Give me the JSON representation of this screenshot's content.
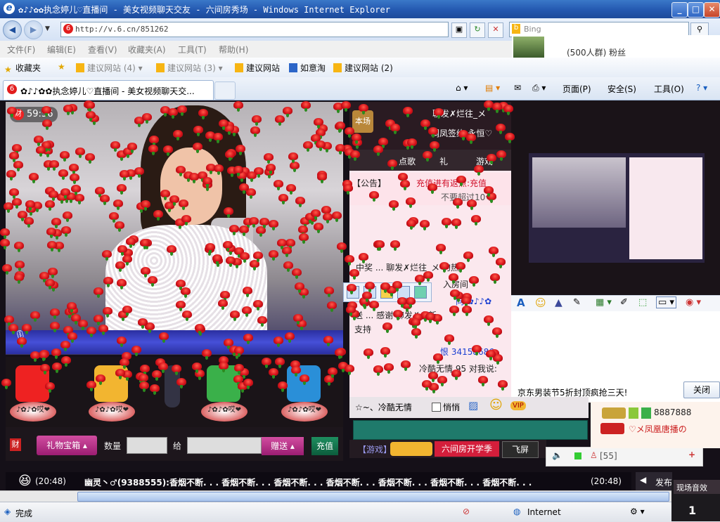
{
  "window": {
    "title": "✿♪♪✿✿执念婷儿♡直播间 - 美女视频聊天交友 - 六间房秀场 - Windows Internet Explorer"
  },
  "address": {
    "url": "http://v.6.cn/851262",
    "search_placeholder": "Bing"
  },
  "menu": [
    "文件(F)",
    "编辑(E)",
    "查看(V)",
    "收藏夹(A)",
    "工具(T)",
    "帮助(H)"
  ],
  "favorites": {
    "label": "收藏夹",
    "items": [
      {
        "label": "建议网站 (4)"
      },
      {
        "label": "建议网站 (3)"
      },
      {
        "label": "建议网站"
      },
      {
        "label": "如意淘"
      },
      {
        "label": "建议网站 (2)"
      }
    ]
  },
  "tab": {
    "label": "✿♪♪✿✿执念婷儿♡直播间 - 美女视频聊天交..."
  },
  "commands": {
    "page": "页面(P)",
    "safety": "安全(S)",
    "tools": "工具(O)"
  },
  "top_right_overlay": {
    "group_text": "(500人群) 粉丝"
  },
  "video": {
    "timer": "59:56",
    "timer_icon": "财"
  },
  "chat": {
    "header_title": "聊发✗烂往_メ",
    "header_sub": "凋凤签约-永恒♡",
    "header_badge": "本场",
    "tabs": [
      "点歌",
      "礼",
      "游戏"
    ],
    "announce_label": "【公告】",
    "announce_text": "充值进有返点:充值",
    "announce_line2": "不要超过10个",
    "lines": [
      {
        "text": "中奖 ... 聊发✗烂往_メ 的热"
      },
      {
        "text": "入房间"
      },
      {
        "text": "向 ✿♪♪✿"
      },
      {
        "text": "送 ... 感谢 聊发✗小新"
      },
      {
        "text": "支持"
      },
      {
        "text": "恨 34158686"
      },
      {
        "text": "冷酷无情 95 对我说:"
      }
    ]
  },
  "gifts": [
    {
      "label": "♪✿♪✿哎❤"
    },
    {
      "label": "♪✿♪✿哎❤"
    },
    {
      "label": "♪✿♪✿哎❤"
    },
    {
      "label": "♪✿♪✿哎❤"
    },
    {
      "label": "♪✿♪✿哎❤"
    }
  ],
  "controls": {
    "cai": "财",
    "giftbox": "礼物宝箱",
    "quantity": "数量",
    "give": "给",
    "send": "赠送",
    "recharge": "充值"
  },
  "input_area": {
    "nickname": "☆~、冷酷无情",
    "whisper": "悄悄",
    "game_label": "【游戏】",
    "game_promo": "六间房开学季",
    "fly_screen": "飞屏",
    "online_count": "[55]"
  },
  "fans": {
    "badge1": "8887888",
    "user": "♡メ凤凰唐播の"
  },
  "popup": {
    "ad_text": "京东男装节5折封顶疯抢三天!",
    "close": "关闭"
  },
  "marquee": {
    "time1": "(20:48)",
    "text": "幽灵丶♂(9388555):香烟不断. . . 香烟不断. . . 香烟不断. . . 香烟不断. . . 香烟不断. . . 香烟不断. . . 香烟不断. . .",
    "time2": "(20:48)",
    "action": "发布"
  },
  "status": {
    "left": "完成",
    "zone": "Internet",
    "xianchang": "现场音效",
    "task_number": "1"
  }
}
